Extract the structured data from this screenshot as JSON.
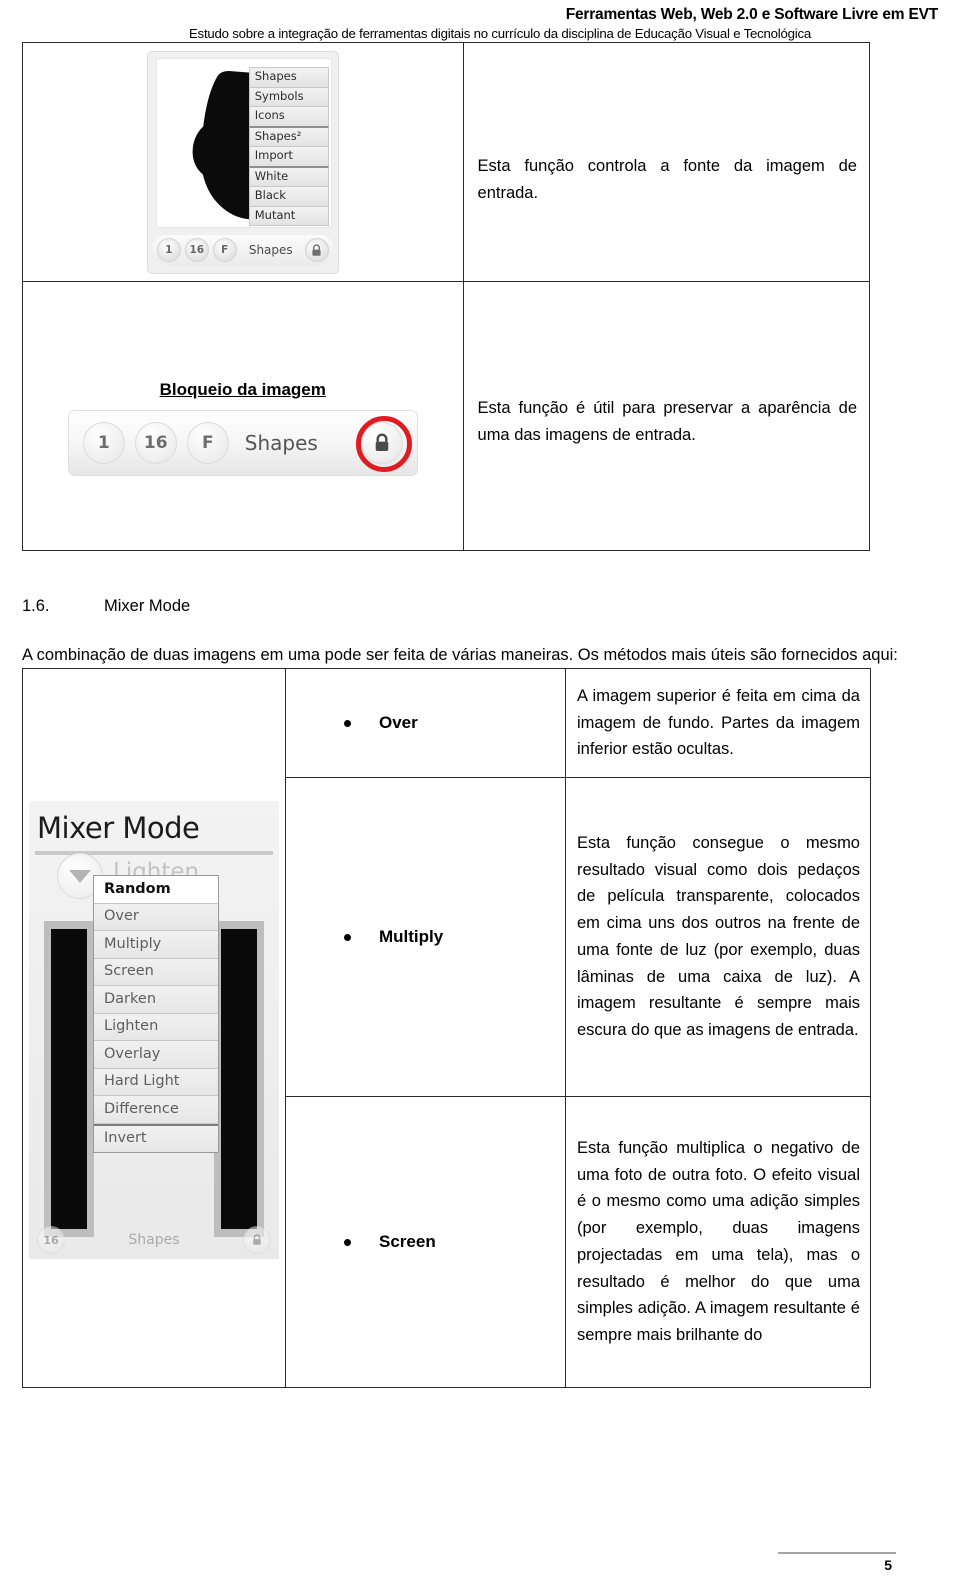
{
  "header": {
    "title": "Ferramentas Web, Web 2.0 e Software Livre em EVT",
    "subtitle": "Estudo sobre a integração de ferramentas digitais no currículo da disciplina de Educação Visual e Tecnológica"
  },
  "table_source": {
    "description": "Esta função controla a fonte da imagem de entrada.",
    "widget": {
      "menu_items": [
        "Shapes",
        "Symbols",
        "Icons",
        "Shapes²",
        "Import",
        "White",
        "Black",
        "Mutant"
      ],
      "bottom_bar": {
        "btn1": "1",
        "btn2": "16",
        "btn3": "F",
        "label": "Shapes",
        "lock_icon": "lock-icon"
      }
    }
  },
  "table_lock": {
    "heading": "Bloqueio da imagem",
    "description": "Esta função é útil para preservar a aparência de uma das imagens de entrada.",
    "strip": {
      "btn1": "1",
      "btn2": "16",
      "btn3": "F",
      "label": "Shapes",
      "lock_icon": "lock-icon",
      "highlight_color": "#e11b22"
    }
  },
  "section": {
    "number": "1.6.",
    "title": "Mixer Mode",
    "intro": "A combinação de duas imagens em uma pode ser feita de várias maneiras. Os métodos mais úteis são fornecidos aqui:"
  },
  "mixer_panel": {
    "title": "Mixer Mode",
    "ghost_label": "Lighten",
    "dropdown_items": [
      "Random",
      "Over",
      "Multiply",
      "Screen",
      "Darken",
      "Lighten",
      "Overlay",
      "Hard Light",
      "Difference",
      "Invert"
    ],
    "selected_item": "Random",
    "bottom_bar": {
      "btn2": "16",
      "label": "Shapes",
      "lock_icon": "lock-icon"
    }
  },
  "modes": [
    {
      "label": "Over",
      "description": "A imagem superior é feita em cima da imagem de fundo. Partes da imagem inferior estão ocultas."
    },
    {
      "label": "Multiply",
      "description": "Esta função consegue o mesmo resultado visual como dois pedaços de película transparente, colocados em cima uns dos outros na frente de uma fonte de luz (por exemplo, duas lâminas de uma caixa de luz). A imagem resultante é sempre mais escura do que as imagens de entrada."
    },
    {
      "label": "Screen",
      "description": "Esta função multiplica o negativo de uma foto de outra foto. O efeito visual é o mesmo como uma adição simples (por exemplo, duas imagens projectadas em uma tela), mas o resultado é melhor do que uma simples adição. A imagem resultante é sempre mais brilhante do"
    }
  ],
  "footer": {
    "page_number": "5"
  }
}
